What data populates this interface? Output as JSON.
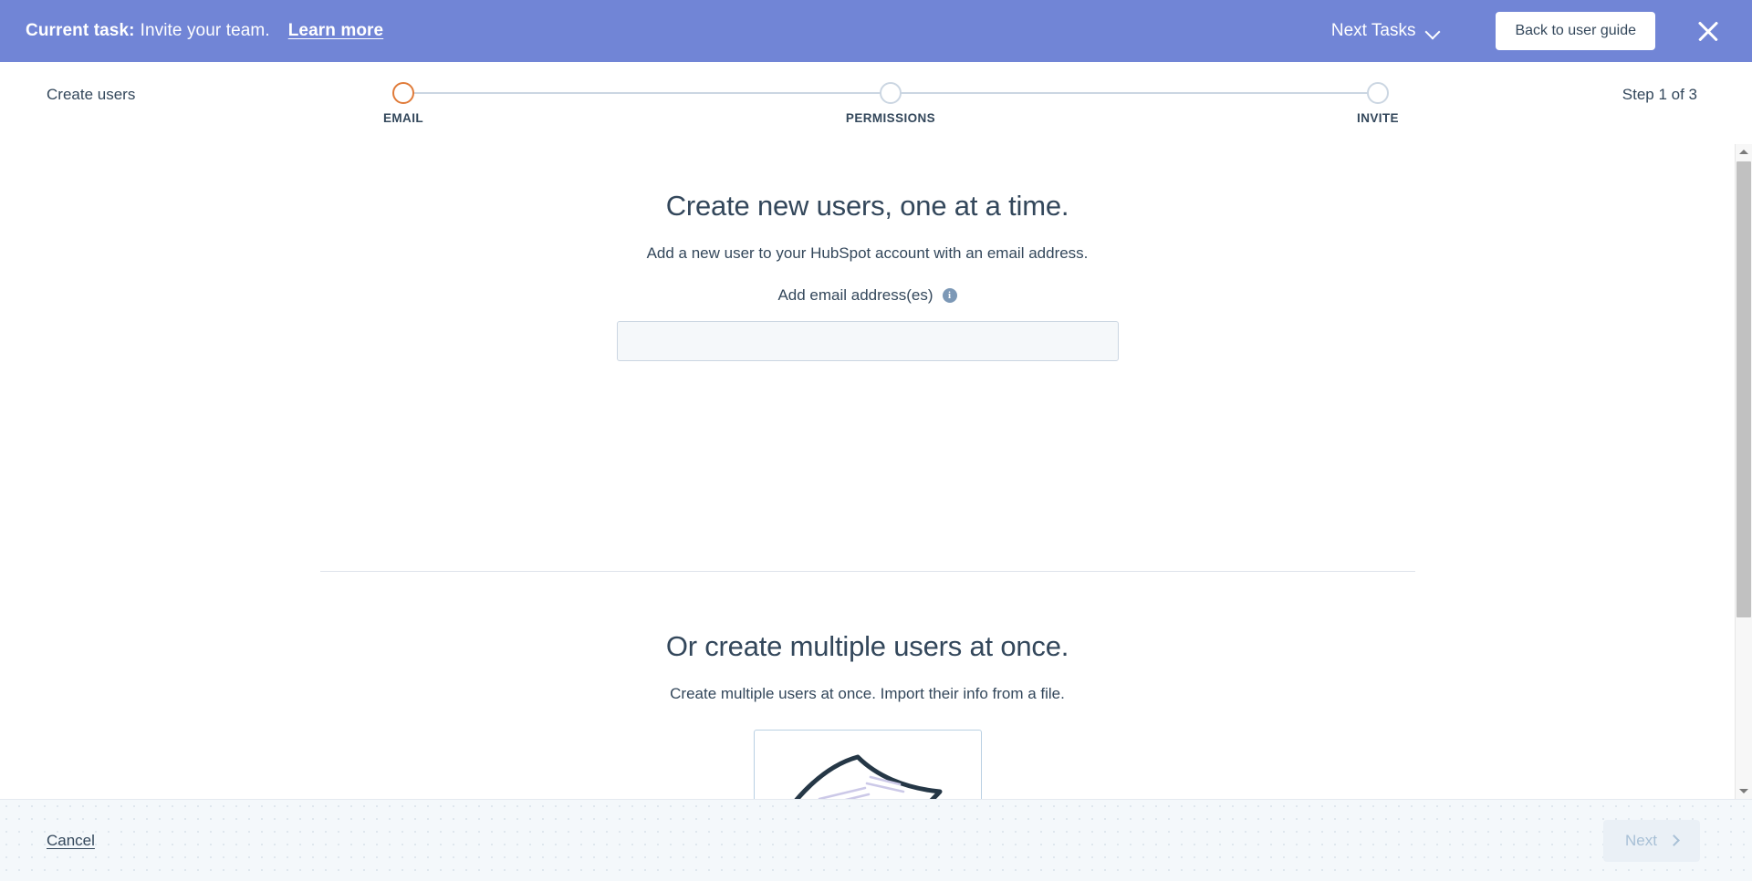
{
  "task_bar": {
    "task_label": "Current task:",
    "task_text": "Invite your team.",
    "learn_more": "Learn more",
    "next_tasks": "Next Tasks",
    "back_to_guide": "Back to user guide",
    "close_icon": "close-icon",
    "chevron_icon": "chevron-down-icon",
    "background_color": "#7185d6"
  },
  "step_header": {
    "breadcrumb": "Create users",
    "step_counter": "Step 1 of 3",
    "steps": [
      {
        "label": "EMAIL",
        "active": true
      },
      {
        "label": "PERMISSIONS",
        "active": false
      },
      {
        "label": "INVITE",
        "active": false
      }
    ],
    "active_color": "#e07b39",
    "inactive_color": "#cbd6e2"
  },
  "main": {
    "heading": "Create new users, one at a time.",
    "subheading": "Add a new user to your HubSpot account with an email address.",
    "email_field_label": "Add email address(es)",
    "info_icon_glyph": "i",
    "email_value": "",
    "email_placeholder": "",
    "second_heading": "Or create multiple users at once.",
    "second_subheading": "Create multiple users at once. Import their info from a file.",
    "file_card_icon": "document-illustration-icon"
  },
  "footer": {
    "cancel_label": "Cancel",
    "next_label": "Next",
    "next_chevron_icon": "chevron-right-icon",
    "next_enabled": false
  },
  "scrollbar": {
    "up_icon": "scroll-up-arrow-icon",
    "down_icon": "scroll-down-arrow-icon"
  }
}
